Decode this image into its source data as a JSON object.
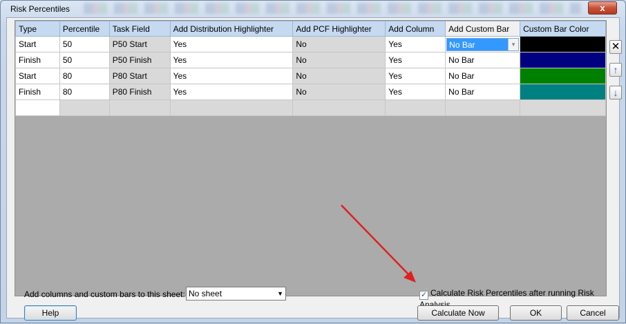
{
  "window": {
    "title": "Risk Percentiles",
    "close_glyph": "x"
  },
  "table": {
    "columns": [
      "Type",
      "Percentile",
      "Task Field",
      "Add Distribution Highlighter",
      "Add PCF Highlighter",
      "Add Column",
      "Add Custom Bar",
      "Custom Bar Color"
    ],
    "rows": [
      {
        "type": "Start",
        "percentile": "50",
        "task_field": "P50 Start",
        "dist": "Yes",
        "pcf": "No",
        "column": "Yes",
        "bar": "No Bar",
        "color": "#000000"
      },
      {
        "type": "Finish",
        "percentile": "50",
        "task_field": "P50 Finish",
        "dist": "Yes",
        "pcf": "No",
        "column": "Yes",
        "bar": "No Bar",
        "color": "#000080"
      },
      {
        "type": "Start",
        "percentile": "80",
        "task_field": "P80 Start",
        "dist": "Yes",
        "pcf": "No",
        "column": "Yes",
        "bar": "No Bar",
        "color": "#008000"
      },
      {
        "type": "Finish",
        "percentile": "80",
        "task_field": "P80 Finish",
        "dist": "Yes",
        "pcf": "No",
        "column": "Yes",
        "bar": "No Bar",
        "color": "#008080"
      }
    ]
  },
  "side_buttons": {
    "delete_icon": "close-icon",
    "up_icon": "arrow-up-icon",
    "down_icon": "arrow-down-icon"
  },
  "sheet_selector": {
    "label": "Add columns and custom bars to this sheet:",
    "value": "No sheet"
  },
  "calculate_checkbox": {
    "label": "Calculate Risk Percentiles after running Risk Analysis",
    "checked": true
  },
  "buttons": {
    "help": "Help",
    "calculate_now": "Calculate Now",
    "ok": "OK",
    "cancel": "Cancel"
  },
  "annotation": {
    "arrow_color": "#e02020"
  }
}
